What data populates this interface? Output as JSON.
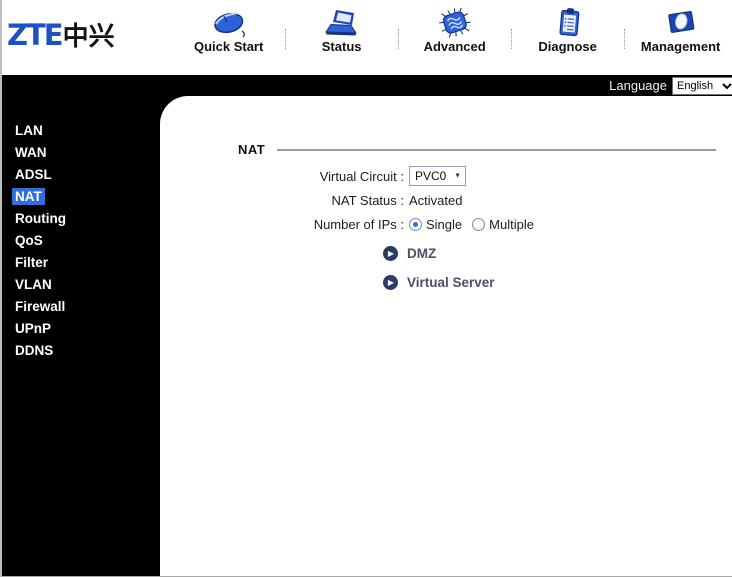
{
  "logo": {
    "zte": "ZTE",
    "cn": "中兴"
  },
  "nav": {
    "items": [
      {
        "label": "Quick Start",
        "icon": "mouse-icon"
      },
      {
        "label": "Status",
        "icon": "laptop-icon"
      },
      {
        "label": "Advanced",
        "icon": "chip-icon"
      },
      {
        "label": "Diagnose",
        "icon": "clipboard-icon"
      },
      {
        "label": "Management",
        "icon": "management-icon"
      }
    ]
  },
  "language_bar": {
    "label": "Language",
    "selected_language": "English"
  },
  "sidebar": {
    "items": [
      {
        "label": "LAN",
        "selected": false
      },
      {
        "label": "WAN",
        "selected": false
      },
      {
        "label": "ADSL",
        "selected": false
      },
      {
        "label": "NAT",
        "selected": true
      },
      {
        "label": "Routing",
        "selected": false
      },
      {
        "label": "QoS",
        "selected": false
      },
      {
        "label": "Filter",
        "selected": false
      },
      {
        "label": "VLAN",
        "selected": false
      },
      {
        "label": "Firewall",
        "selected": false
      },
      {
        "label": "UPnP",
        "selected": false
      },
      {
        "label": "DDNS",
        "selected": false
      }
    ]
  },
  "main": {
    "section_title": "NAT",
    "form": {
      "virtual_circuit": {
        "label": "Virtual Circuit :",
        "value": "PVC0"
      },
      "nat_status": {
        "label": "NAT Status :",
        "value": "Activated"
      },
      "number_of_ips": {
        "label": "Number of IPs :",
        "options": [
          {
            "label": "Single",
            "checked": true
          },
          {
            "label": "Multiple",
            "checked": false
          }
        ]
      }
    },
    "links": [
      {
        "label": "DMZ",
        "icon": "arrow-right-icon"
      },
      {
        "label": "Virtual Server",
        "icon": "arrow-right-icon"
      }
    ]
  },
  "colors": {
    "accent_blue": "#1b52c4",
    "selection_blue": "#2f6fd6",
    "link_navy": "#2b3a66",
    "link_text": "#4a5168",
    "rule_gray": "#9a9a9a"
  }
}
